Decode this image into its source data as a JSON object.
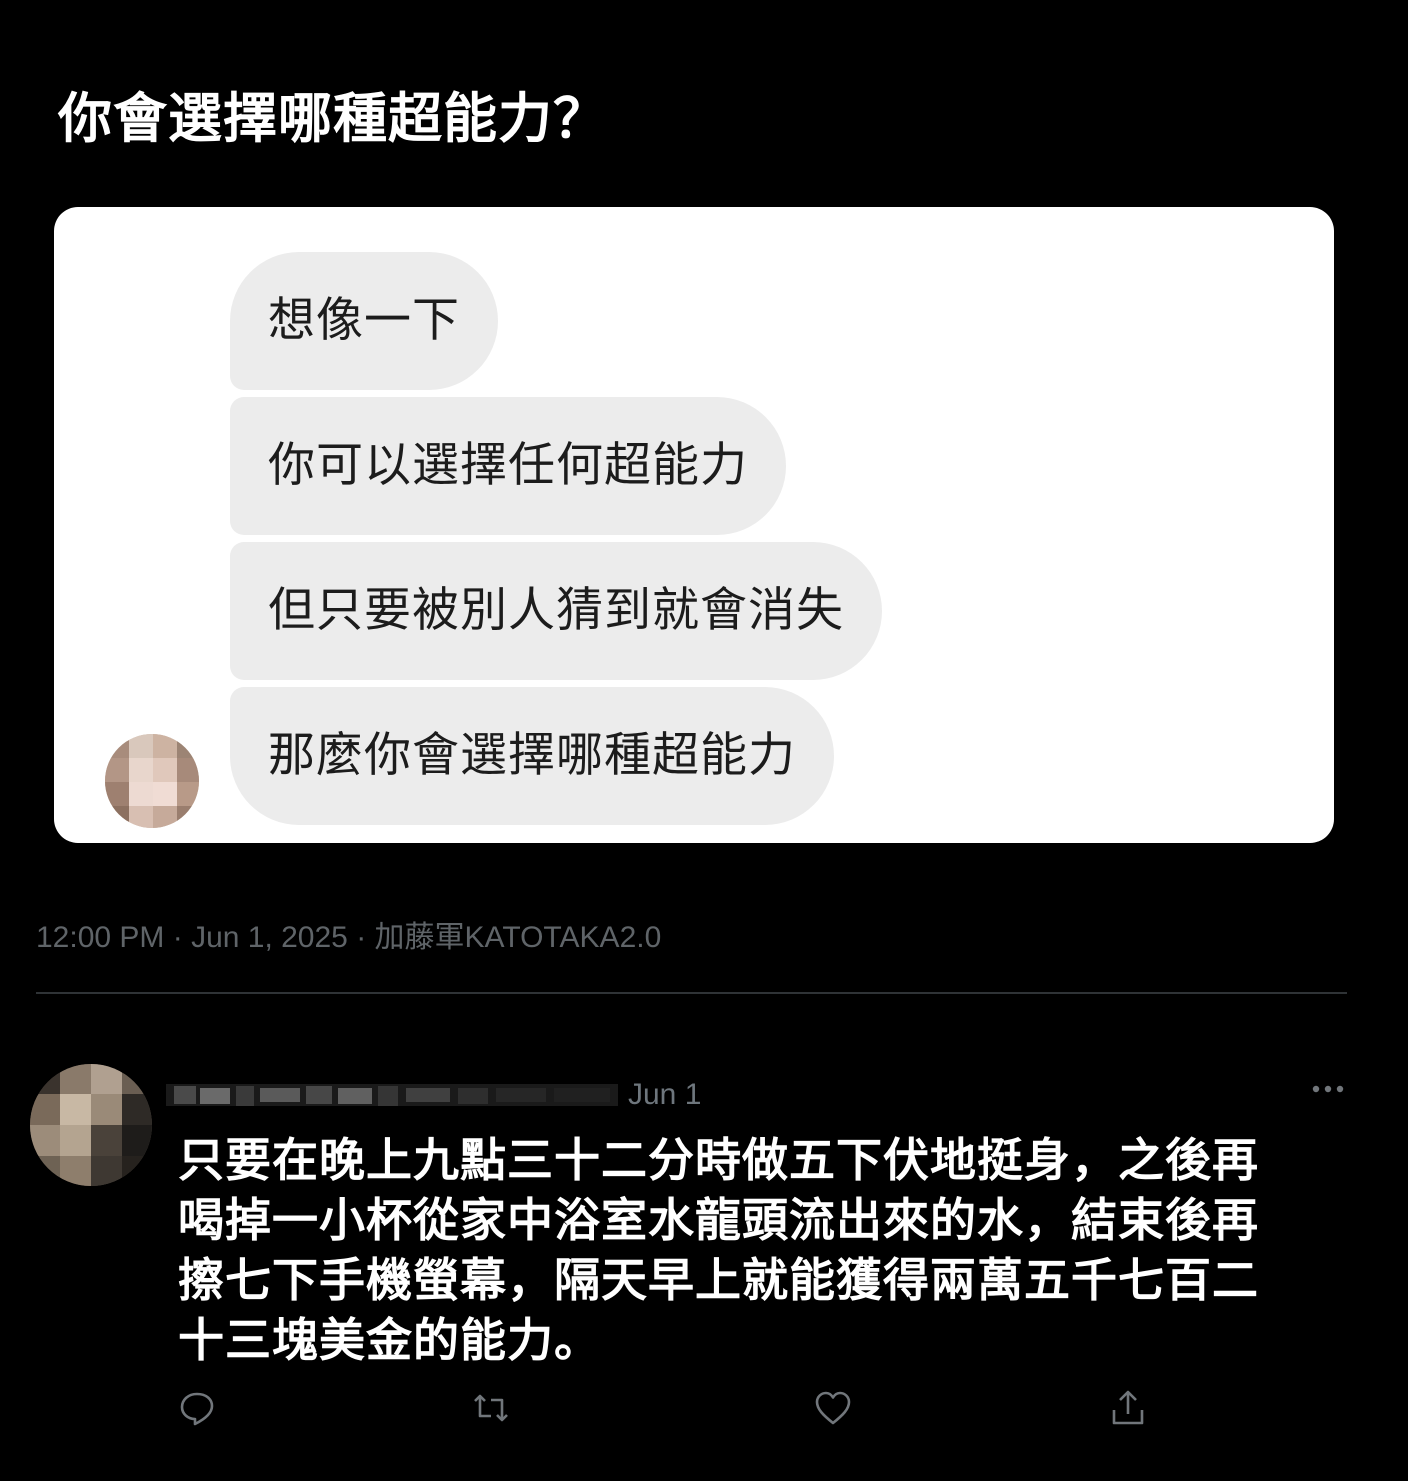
{
  "post": {
    "title": "你會選擇哪種超能力？"
  },
  "chat": {
    "messages": [
      "想像一下",
      "你可以選擇任何超能力",
      "但只要被別人猜到就會消失",
      "那麼你會選擇哪種超能力"
    ],
    "sender_avatar": "blurred-avatar"
  },
  "tweet_meta": {
    "text": "12:00 PM · Jun 1, 2025 · 加藤軍KATOTAKA2.0"
  },
  "reply": {
    "author_name": "",
    "date": "Jun 1",
    "text_lines": [
      "只要在晚上九點三十二分時做五下伏地挺身，之後再",
      "喝掉一小杯從家中浴室水龍頭流出來的水，結束後再",
      "擦七下手機螢幕，隔天早上就能獲得兩萬五千七百二",
      "十三塊美金的能力。"
    ]
  },
  "actions": {
    "reply_icon": "reply-icon",
    "retweet_icon": "retweet-icon",
    "like_icon": "heart-icon",
    "share_icon": "share-icon",
    "more_icon": "more-icon"
  },
  "colors": {
    "background": "#000000",
    "card": "#ffffff",
    "bubble": "#ececec",
    "muted_text": "#5f6468",
    "divider": "#2f3336",
    "icon": "#71767b"
  }
}
